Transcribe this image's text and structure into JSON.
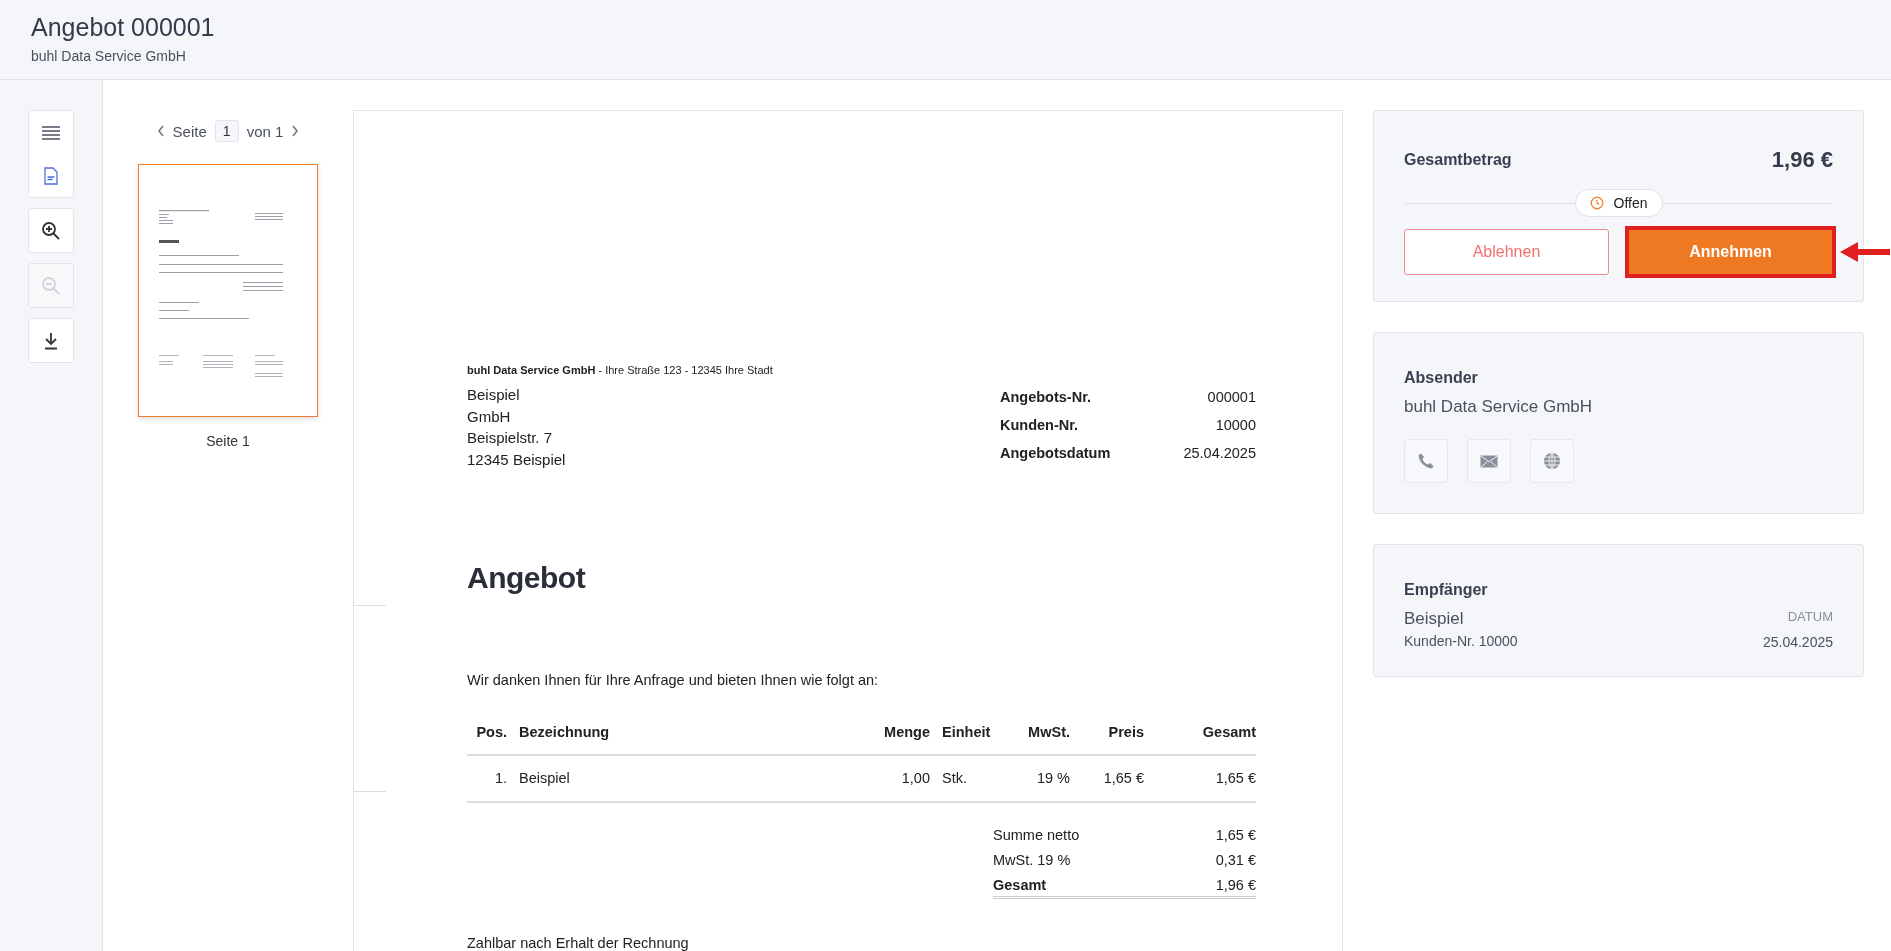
{
  "header": {
    "title": "Angebot 000001",
    "subtitle": "buhl Data Service GmbH"
  },
  "toolbar": [
    {
      "items": [
        {
          "kind": "menu",
          "disabled": false
        },
        {
          "kind": "pdf",
          "disabled": false
        }
      ]
    },
    {
      "items": [
        {
          "kind": "zoom-in",
          "disabled": false
        }
      ]
    },
    {
      "items": [
        {
          "kind": "zoom-out",
          "disabled": true
        }
      ]
    },
    {
      "items": [
        {
          "kind": "download",
          "disabled": false
        }
      ]
    }
  ],
  "pager": {
    "label": "Seite",
    "page": "1",
    "total": "von 1"
  },
  "thumbnails": [
    {
      "caption": "Seite 1",
      "selected": true
    }
  ],
  "document": {
    "sender_line": "**buhl Data Service GmbH** - Ihre Straße 123 - 12345 Ihre Stadt",
    "address": [
      "Beispiel",
      "GmbH",
      "Beispielstr. 7",
      "12345 Beispiel"
    ],
    "meta": [
      {
        "label": "Angebots-Nr.",
        "value": "000001"
      },
      {
        "label": "Kunden-Nr.",
        "value": "10000"
      },
      {
        "label": "Angebotsdatum",
        "value": "25.04.2025"
      }
    ],
    "title": "Angebot",
    "intro": "Wir danken Ihnen für Ihre Anfrage und bieten Ihnen wie folgt an:",
    "table": {
      "columns": [
        "Pos.",
        "Bezeichnung",
        "Menge",
        "Einheit",
        "MwSt.",
        "Preis",
        "Gesamt"
      ],
      "rows": [
        [
          "1.",
          "Beispiel",
          "1,00",
          "Stk.",
          "19 %",
          "1,65 €",
          "1,65 €"
        ]
      ]
    },
    "totals": [
      {
        "kind": "normal",
        "label": "Summe netto",
        "value": "1,65 €"
      },
      {
        "kind": "normal",
        "label": "MwSt. 19 %",
        "value": "0,31 €"
      },
      {
        "kind": "total",
        "label": "Gesamt",
        "value": "1,96 €"
      }
    ],
    "footer_text": "Zahlbar nach Erhalt der Rechnung"
  },
  "summary": {
    "label": "Gesamtbetrag",
    "amount": "1,96 €",
    "status": "Offen",
    "buttons": [
      {
        "kind": "reject",
        "label": "Ablehnen",
        "highlighted": false
      },
      {
        "kind": "accept",
        "label": "Annehmen",
        "highlighted": true
      }
    ]
  },
  "sender": {
    "heading": "Absender",
    "name": "buhl Data Service GmbH",
    "contacts": [
      {
        "kind": "phone"
      },
      {
        "kind": "email"
      },
      {
        "kind": "web"
      }
    ]
  },
  "recipient": {
    "heading": "Empfänger",
    "name": "Beispiel",
    "customer": "Kunden-Nr. 10000",
    "date_label": "DATUM",
    "date": "25.04.2025"
  }
}
